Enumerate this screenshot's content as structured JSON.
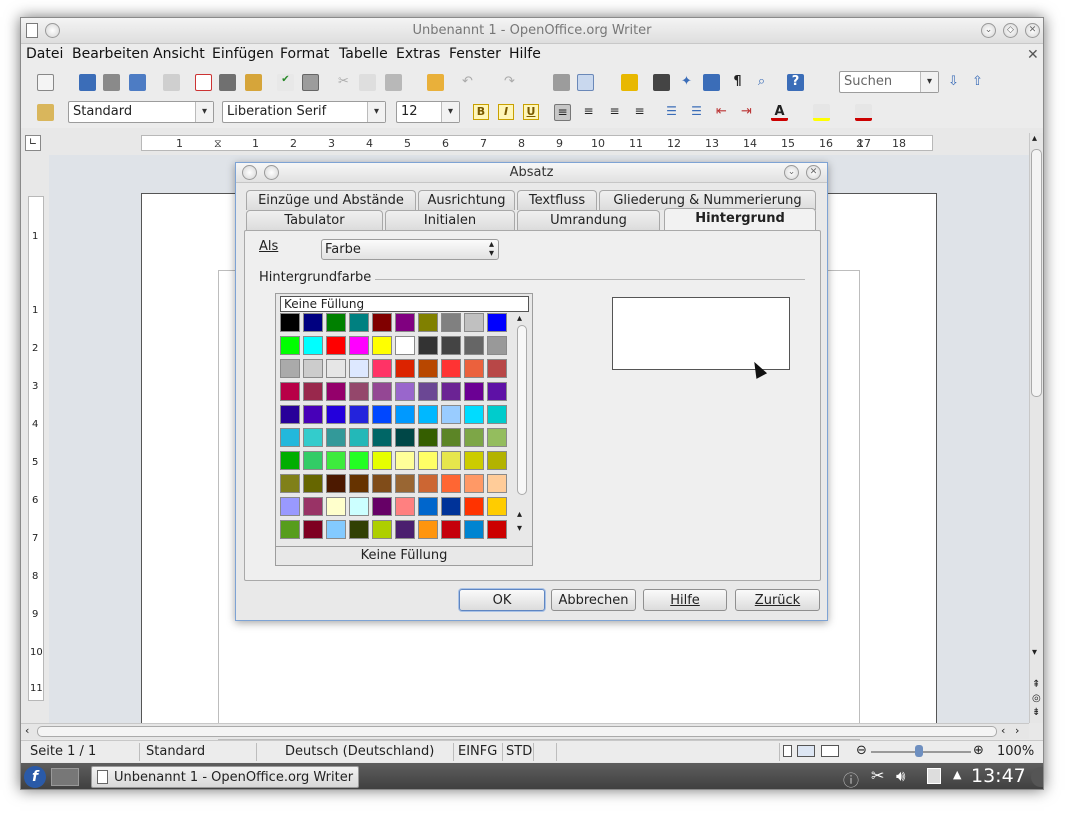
{
  "window": {
    "title": "Unbenannt 1 - OpenOffice.org Writer"
  },
  "menu": [
    {
      "label": "Datei"
    },
    {
      "label": "Bearbeiten"
    },
    {
      "label": "Ansicht"
    },
    {
      "label": "Einfügen"
    },
    {
      "label": "Format"
    },
    {
      "label": "Tabelle"
    },
    {
      "label": "Extras"
    },
    {
      "label": "Fenster"
    },
    {
      "label": "Hilfe"
    }
  ],
  "toolbar": {
    "search_placeholder": "Suchen"
  },
  "format_toolbar": {
    "style_value": "Standard",
    "font_value": "Liberation Serif",
    "size_value": "12",
    "bold": "B",
    "italic": "I",
    "underline": "U"
  },
  "ruler": {
    "labels": [
      "1",
      "1",
      "2",
      "3",
      "4",
      "5",
      "6",
      "7",
      "8",
      "9",
      "10",
      "11",
      "12",
      "13",
      "14",
      "15",
      "16",
      "17",
      "18"
    ]
  },
  "vruler": {
    "labels": [
      "1",
      "1",
      "2",
      "3",
      "4",
      "5",
      "6",
      "7",
      "8",
      "9",
      "10",
      "11"
    ]
  },
  "dialog": {
    "title": "Absatz",
    "tabs_row1": [
      "Einzüge und Abstände",
      "Ausrichtung",
      "Textfluss",
      "Gliederung & Nummerierung"
    ],
    "tabs_row2": [
      "Tabulator",
      "Initialen",
      "Umrandung",
      "Hintergrund"
    ],
    "active_tab": "Hintergrund",
    "as_label": "Als",
    "as_value": "Farbe",
    "section_label": "Hintergrundfarbe",
    "no_fill_top": "Keine Füllung",
    "no_fill_bottom": "Keine Füllung",
    "buttons": {
      "ok": "OK",
      "cancel": "Abbrechen",
      "help": "Hilfe",
      "back": "Zurück"
    }
  },
  "colors": [
    "#000000",
    "#000080",
    "#008000",
    "#008080",
    "#800000",
    "#800080",
    "#808000",
    "#808080",
    "#c0c0c0",
    "#0000ff",
    "#00ff00",
    "#00ffff",
    "#ff0000",
    "#ff00ff",
    "#ffff00",
    "#ffffff",
    "#333333",
    "#444444",
    "#666666",
    "#999999",
    "#aaaaaa",
    "#cccccc",
    "#e6e6e6",
    "#dde8ff",
    "#ff3366",
    "#dc2300",
    "#b84700",
    "#ff3333",
    "#eb613d",
    "#b84747",
    "#b80047",
    "#99284c",
    "#94006b",
    "#94476b",
    "#944794",
    "#9966cc",
    "#6b4794",
    "#6b2394",
    "#6b0094",
    "#5e11a6",
    "#280099",
    "#4700b8",
    "#2300dc",
    "#2323dc",
    "#0047ff",
    "#0099ff",
    "#00b8ff",
    "#99ccff",
    "#00dcff",
    "#00cccc",
    "#23b8dc",
    "#33cccc",
    "#339999",
    "#23b8b8",
    "#006666",
    "#004747",
    "#355e00",
    "#5c8526",
    "#7da647",
    "#94bd5e",
    "#00ae00",
    "#33cc66",
    "#3deb3d",
    "#23ff23",
    "#e6ff00",
    "#ffff99",
    "#ffff66",
    "#e6e64c",
    "#cccc00",
    "#b3b300",
    "#808019",
    "#666600",
    "#4c1900",
    "#663300",
    "#804c19",
    "#996633",
    "#cc6633",
    "#ff6633",
    "#ff9966",
    "#ffcc99",
    "#9999ff",
    "#993366",
    "#ffffcc",
    "#ccffff",
    "#660066",
    "#ff8080",
    "#0066cc",
    "#003399",
    "#ff3300",
    "#ffcc00",
    "#579d1c",
    "#7e0021",
    "#83caff",
    "#314004",
    "#aecf00",
    "#4b1f6f",
    "#ff950e",
    "#c5000b",
    "#0084d1",
    "#cc0000"
  ],
  "statusbar": {
    "page": "Seite 1 / 1",
    "style": "Standard",
    "language": "Deutsch (Deutschland)",
    "insert": "EINFG",
    "selection": "STD",
    "zoom": "100%"
  },
  "taskbar": {
    "task": "Unbenannt 1 - OpenOffice.org Writer",
    "clock": "13:47"
  }
}
